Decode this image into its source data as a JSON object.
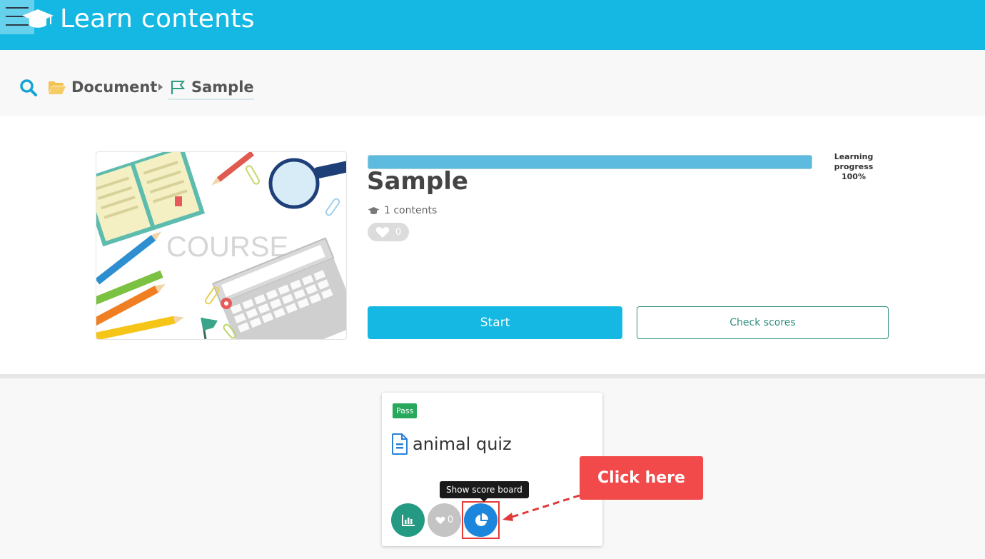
{
  "header": {
    "title": "Learn contents",
    "icons": {
      "menu": "hamburger-icon",
      "logo": "graduation-cap-icon"
    }
  },
  "breadcrumb": {
    "folder": "Document",
    "current": "Sample",
    "icons": {
      "search": "search-icon",
      "folder": "folder-open-icon",
      "separator": "caret-right-icon",
      "current": "flag-icon"
    }
  },
  "course": {
    "title": "Sample",
    "thumbnail_text": "COURSE",
    "progress": {
      "label": "Learning progress",
      "value_text": "100%",
      "fraction": 1.0
    },
    "contents_count": "1 contents",
    "likes": "0",
    "start_label": "Start",
    "check_scores_label": "Check scores"
  },
  "content_card": {
    "badge": "Pass",
    "title": "animal quiz",
    "likes": "0",
    "tooltip": "Show score board",
    "icons": {
      "doc": "document-icon",
      "stats": "bar-chart-icon",
      "like": "heart-icon",
      "score": "pie-chart-icon"
    }
  },
  "annotation": {
    "callout": "Click here"
  },
  "colors": {
    "brand": "#14b8e2",
    "pass": "#27a85a",
    "accent_green": "#2f8f7f",
    "score_blue": "#1c86dc",
    "callout_red": "#f24a4a"
  }
}
